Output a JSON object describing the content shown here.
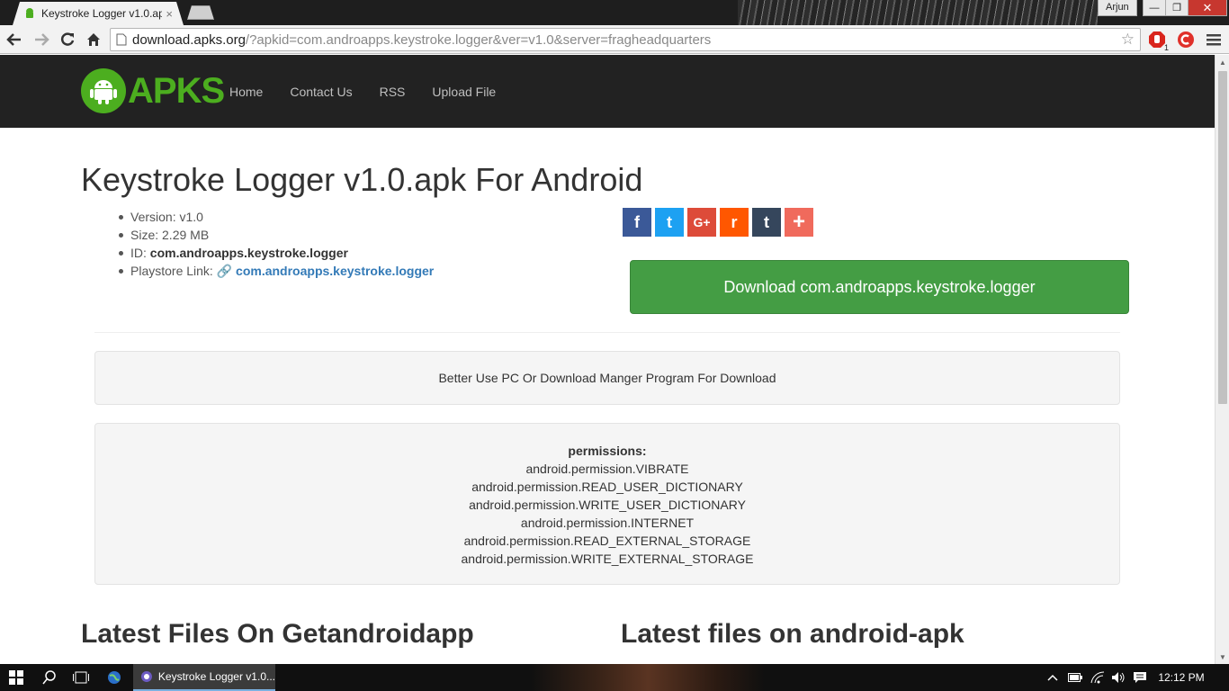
{
  "browser": {
    "tab_title": "Keystroke Logger v1.0.apk",
    "tab_close": "×",
    "profile_name": "Arjun",
    "window_controls": {
      "minimize": "—",
      "maximize": "❐",
      "close": "✕"
    },
    "url_host": "download.apks.org",
    "url_rest": "/?apkid=com.androapps.keystroke.logger&ver=v1.0&server=fragheadquarters",
    "star_glyph": "☆",
    "extension_badge": "1"
  },
  "site": {
    "logo_text": "APKS",
    "nav": [
      "Home",
      "Contact Us",
      "RSS",
      "Upload File"
    ]
  },
  "page": {
    "title": "Keystroke Logger v1.0.apk For Android",
    "info": {
      "version_label": "Version: v1.0",
      "size_label": "Size: 2.29 MB",
      "id_prefix": "ID: ",
      "id_value": "com.androapps.keystroke.logger",
      "playstore_prefix": "Playstore Link: ",
      "playstore_link": "com.androapps.keystroke.logger"
    },
    "share_buttons": [
      {
        "name": "facebook",
        "glyph": "f",
        "color": "#3b5998"
      },
      {
        "name": "twitter",
        "glyph": "t",
        "color": "#1da1f2"
      },
      {
        "name": "google-plus",
        "glyph": "G+",
        "color": "#dd4b39"
      },
      {
        "name": "reddit",
        "glyph": "r",
        "color": "#ff5700"
      },
      {
        "name": "tumblr",
        "glyph": "t",
        "color": "#35465c"
      },
      {
        "name": "more",
        "glyph": "+",
        "color": "#f06a5c"
      }
    ],
    "download_button": "Download com.androapps.keystroke.logger",
    "notice": "Better Use PC Or Download Manger Program For Download",
    "permissions_heading": "permissions:",
    "permissions": [
      "android.permission.VIBRATE",
      "android.permission.READ_USER_DICTIONARY",
      "android.permission.WRITE_USER_DICTIONARY",
      "android.permission.INTERNET",
      "android.permission.READ_EXTERNAL_STORAGE",
      "android.permission.WRITE_EXTERNAL_STORAGE"
    ],
    "latest_left": "Latest Files On Getandroidapp",
    "latest_right": "Latest files on android-apk"
  },
  "taskbar": {
    "app_label": "Keystroke Logger v1.0...",
    "clock": "12:12 PM"
  },
  "colors": {
    "brand_green": "#4cae1f",
    "download_green": "#449d44",
    "nav_bg": "#222222",
    "link_blue": "#337ab7"
  }
}
